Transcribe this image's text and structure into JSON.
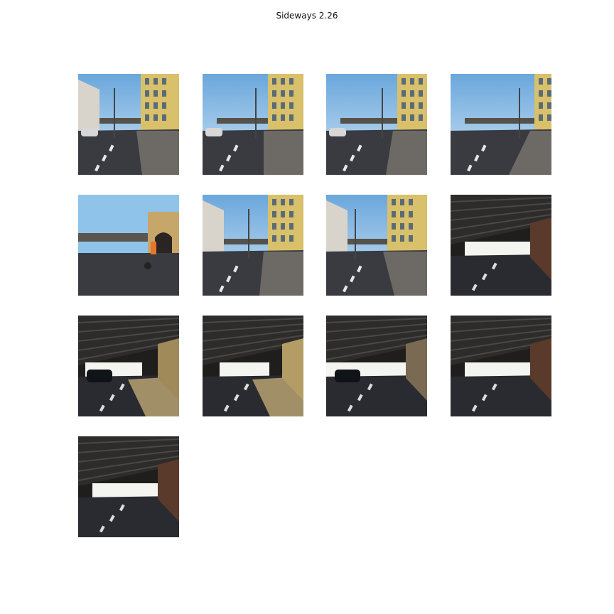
{
  "figure": {
    "title": "Sideways 2.26"
  },
  "colors": {
    "sky": "#8fc3ea",
    "facade": "#d9c06a",
    "asphalt": "#3a3b40",
    "underpass_ceiling": "#2e2c2a"
  },
  "grid": {
    "columns": 4,
    "rows": 4,
    "tile_count": 13
  },
  "tiles": [
    {
      "scene": "street-traffic-light"
    },
    {
      "scene": "street-railing"
    },
    {
      "scene": "street-lamp-railing"
    },
    {
      "scene": "street-sign-bikes"
    },
    {
      "scene": "gateway-building-cyclist"
    },
    {
      "scene": "street-intersection"
    },
    {
      "scene": "street-bike-lane"
    },
    {
      "scene": "underpass"
    },
    {
      "scene": "underpass-parked-car"
    },
    {
      "scene": "underpass-sunlit"
    },
    {
      "scene": "underpass-exit"
    },
    {
      "scene": "underpass"
    },
    {
      "scene": "underpass"
    }
  ]
}
